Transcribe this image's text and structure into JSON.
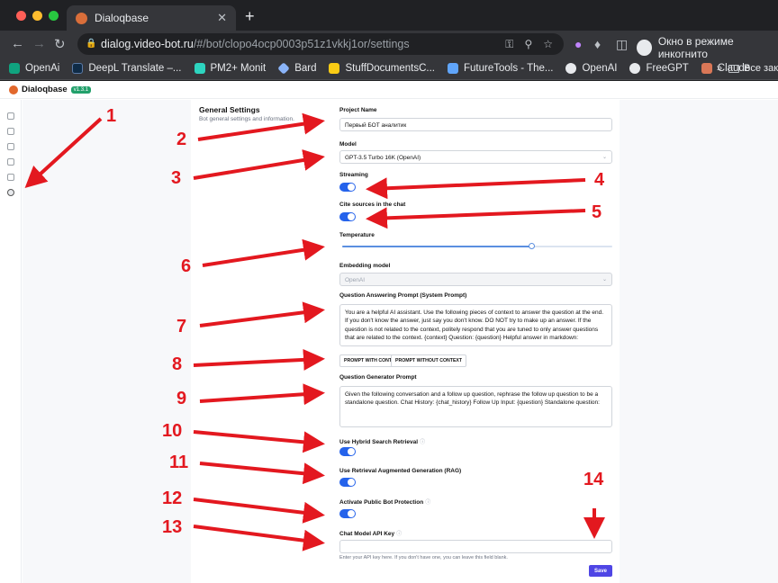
{
  "browser": {
    "tab_title": "Dialoqbase",
    "tab_close": "✕",
    "new_tab": "+",
    "url_host": "dialog.video-bot.ru",
    "url_path": "/#/bot/clopo4ocp0003p51z1vkkj1or/settings",
    "profile_label": "Окно в режиме инкогнито",
    "bookmarks": [
      {
        "label": "OpenAi",
        "color": "#10a37f"
      },
      {
        "label": "DeepL Translate –...",
        "color": "#0f2b46"
      },
      {
        "label": "PM2+ Monit",
        "color": "#2dd4bf"
      },
      {
        "label": "Bard",
        "color": "#8ab4f8"
      },
      {
        "label": "StuffDocumentsC...",
        "color": "#facc15"
      },
      {
        "label": "FutureTools - The...",
        "color": "#60a5fa"
      },
      {
        "label": "OpenAI",
        "color": "#e8eaed"
      },
      {
        "label": "FreeGPT",
        "color": "#e8eaed"
      },
      {
        "label": "Claude",
        "color": "#d97757"
      }
    ],
    "bookmarks_more": "»",
    "bookmarks_folder": "Все зак"
  },
  "app": {
    "brand": "Dialoqbase",
    "version": "v1.3.1"
  },
  "settings": {
    "title": "General Settings",
    "subtitle": "Bot general settings and information.",
    "project_name_label": "Project Name",
    "project_name_value": "Первый БОТ аналитик",
    "model_label": "Model",
    "model_value": "GPT-3.5 Turbo 16K (OpenAI)",
    "streaming_label": "Streaming",
    "streaming_on": true,
    "cite_label": "Cite sources in the chat",
    "cite_on": true,
    "temperature_label": "Temperature",
    "temperature_value": 0.7,
    "embedding_label": "Embedding model",
    "embedding_value": "OpenAI",
    "qa_prompt_label": "Question Answering Prompt (System Prompt)",
    "qa_prompt_value": "You are a helpful AI assistant. Use the following pieces of context to answer the question at the end. If you don't know the answer, just say you don't know. DO NOT try to make up an answer. If the question is not related to the context, politely respond that you are tuned to only answer questions that are related to the context.  {context}  Question: {question} Helpful answer in markdown:",
    "prompt_with_context": "PROMPT WITH CONTEXT",
    "prompt_without_context": "PROMPT WITHOUT CONTEXT",
    "qg_prompt_label": "Question Generator Prompt",
    "qg_prompt_value": "Given the following conversation and a follow up question, rephrase the follow up question to be a standalone question.   Chat History: {chat_history} Follow Up Input: {question} Standalone question:",
    "hybrid_label": "Use Hybrid Search Retrieval",
    "hybrid_on": true,
    "rag_label": "Use Retrieval Augmented Generation (RAG)",
    "rag_on": true,
    "public_label": "Activate Public Bot Protection",
    "public_on": true,
    "api_key_label": "Chat Model API Key",
    "api_key_value": "",
    "api_key_hint": "Enter your API key here. If you don't have one, you can leave this field blank.",
    "save_label": "Save"
  },
  "annotations": {
    "color": "#e3181f",
    "numbers": [
      "1",
      "2",
      "3",
      "4",
      "5",
      "6",
      "7",
      "8",
      "9",
      "10",
      "11",
      "12",
      "13",
      "14"
    ]
  }
}
